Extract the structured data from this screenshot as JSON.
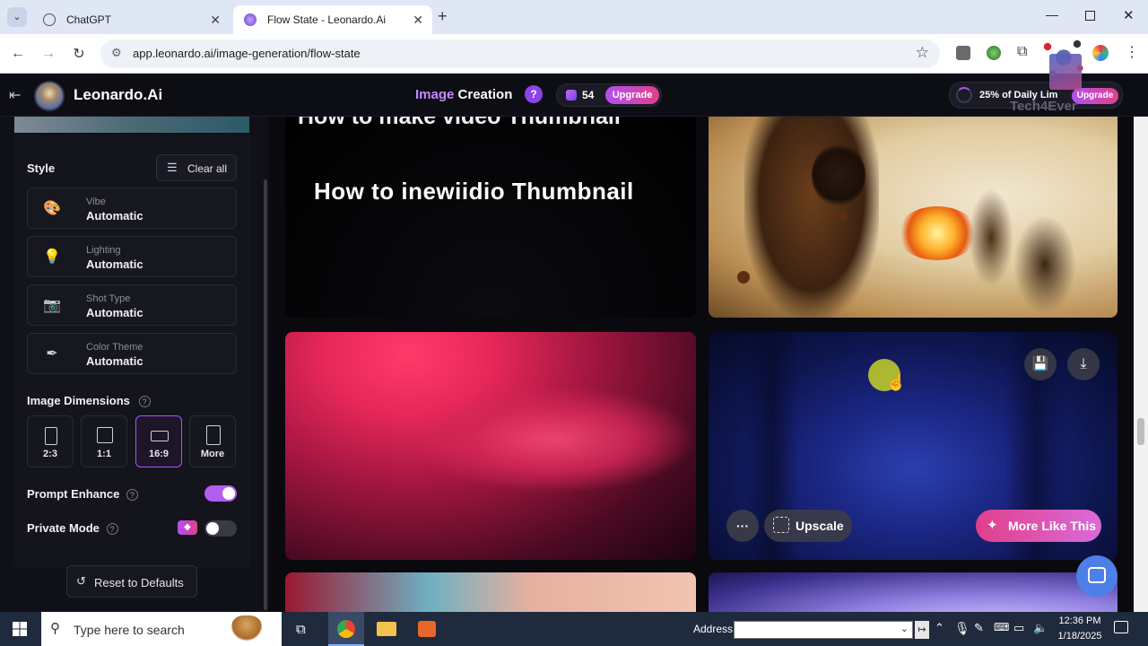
{
  "browser": {
    "tabs": [
      {
        "title": "ChatGPT",
        "active": false
      },
      {
        "title": "Flow State - Leonardo.Ai",
        "active": true
      }
    ],
    "url": "app.leonardo.ai/image-generation/flow-state"
  },
  "header": {
    "brand": "Leonardo.Ai",
    "section_image": "Image",
    "section_creation": "Creation",
    "help": "?",
    "tokens": "54",
    "upgrade": "Upgrade",
    "daily_limit": "25% of Daily Lim",
    "upgrade2": "Upgrade"
  },
  "watermark": {
    "text": "Tech4Ever"
  },
  "sidebar": {
    "style_title": "Style",
    "clear_all": "Clear all",
    "options": [
      {
        "label": "Vibe",
        "value": "Automatic",
        "icon": "palette-icon"
      },
      {
        "label": "Lighting",
        "value": "Automatic",
        "icon": "lightbulb-icon"
      },
      {
        "label": "Shot Type",
        "value": "Automatic",
        "icon": "camera-icon"
      },
      {
        "label": "Color Theme",
        "value": "Automatic",
        "icon": "eyedropper-icon"
      }
    ],
    "dimensions_title": "Image Dimensions",
    "dimensions": [
      {
        "label": "2:3",
        "selected": false
      },
      {
        "label": "1:1",
        "selected": false
      },
      {
        "label": "16:9",
        "selected": true
      },
      {
        "label": "More",
        "selected": false
      }
    ],
    "prompt_enhance": "Prompt Enhance",
    "prompt_enhance_on": true,
    "private_mode": "Private Mode",
    "private_mode_on": false,
    "reset": "Reset to Defaults"
  },
  "gallery": {
    "thumb_top_text": "How to make video Thumbnail",
    "thumb_main_text": "How to inewiidio Thumbnail",
    "upscale": "Upscale",
    "more_like_this": "More Like This",
    "more_menu": "···"
  },
  "taskbar": {
    "search_placeholder": "Type here to search",
    "address_label": "Address",
    "time": "12:36 PM",
    "date": "1/18/2025"
  },
  "colors": {
    "accent_purple": "#a855f7",
    "accent_pink": "#e0408a",
    "toggle_on": "#b35cf0"
  }
}
